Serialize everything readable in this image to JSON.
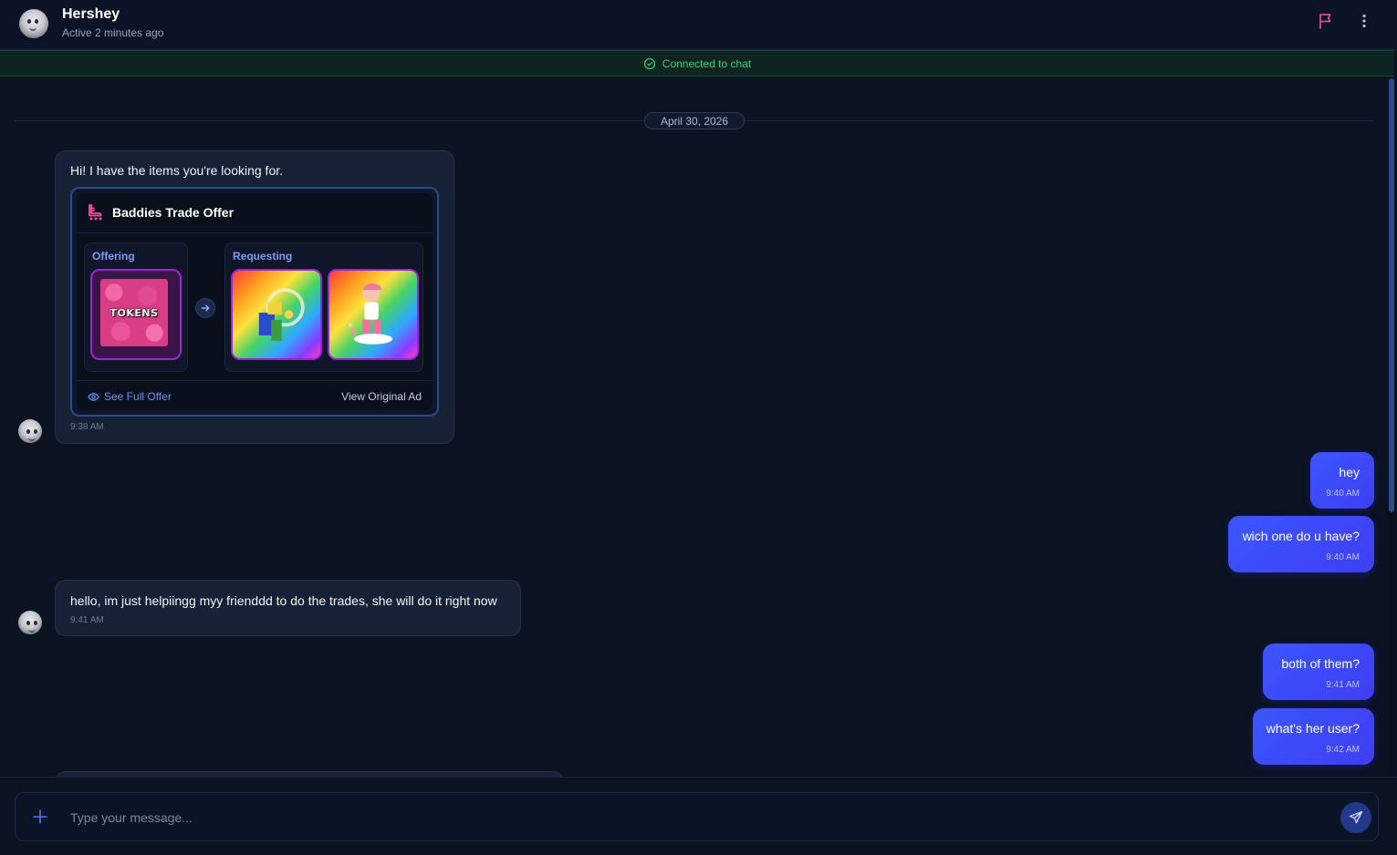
{
  "header": {
    "name": "Hershey",
    "status": "Active 2 minutes ago"
  },
  "banner": {
    "text": "Connected to chat",
    "color": "#3ecf7a"
  },
  "date_divider": "April 30, 2026",
  "messages": [
    {
      "from": "them",
      "text": "Hi! I have the items you're looking for.",
      "time": "9:38 AM",
      "trade": {
        "title": "Baddies Trade Offer",
        "offering_label": "Offering",
        "offering_item": "TOKENS",
        "requesting_label": "Requesting",
        "see_full": "See Full Offer",
        "view_original": "View Original Ad"
      }
    },
    {
      "from": "me",
      "text": "hey",
      "time": "9:40 AM"
    },
    {
      "from": "me",
      "text": "wich one do u have?",
      "time": "9:40 AM"
    },
    {
      "from": "them",
      "text": "hello, im just helpiingg myy frienddd to do the trades, she will do it right now",
      "time": "9:41 AM"
    },
    {
      "from": "me",
      "text": "both of them?",
      "time": "9:41 AM"
    },
    {
      "from": "me",
      "text": "what's her user?",
      "time": "9:42 AM"
    }
  ],
  "composer": {
    "placeholder": "Type your message..."
  },
  "colors": {
    "accent": "#3b56ff",
    "flag": "#e0458f",
    "link": "#6f93f5"
  },
  "icons": [
    "flag-icon",
    "more-vertical-icon",
    "check-circle-icon",
    "arrow-right-icon",
    "eye-icon",
    "plus-icon",
    "send-icon",
    "skate-icon"
  ]
}
